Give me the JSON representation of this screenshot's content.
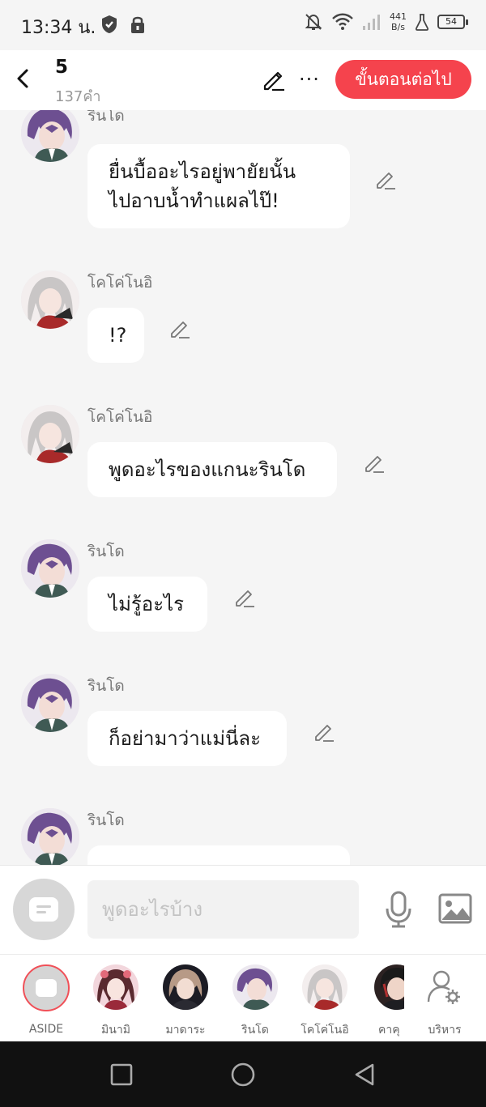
{
  "status_bar": {
    "time": "13:34 น.",
    "speed_value": "441",
    "speed_unit": "B/s",
    "battery": "54"
  },
  "header": {
    "title": "5",
    "subtitle": "137คำ",
    "next_button": "ขั้นตอนต่อไป",
    "more_label": "···"
  },
  "messages": [
    {
      "name": "รินโด",
      "text_lines": [
        "ยื่นบื้ออะไรอยู่พายัยนั้น",
        "ไปอาบน้ำทำแผลไป๊!"
      ]
    },
    {
      "name": "โคโค่โนอิ",
      "text_lines": [
        "!?"
      ]
    },
    {
      "name": "โคโค่โนอิ",
      "text_lines": [
        "พูดอะไรของแกนะรินโด"
      ]
    },
    {
      "name": "รินโด",
      "text_lines": [
        "ไม่รู้อะไร"
      ]
    },
    {
      "name": "รินโด",
      "text_lines": [
        "ก็อย่ามาว่าแม่นี่ละ"
      ]
    },
    {
      "name": "รินโด",
      "text_lines": [
        ""
      ]
    }
  ],
  "input": {
    "placeholder": "พูดอะไรบ้าง"
  },
  "characters": [
    {
      "label": "ASIDE"
    },
    {
      "label": "มินามิ"
    },
    {
      "label": "มาดาระ"
    },
    {
      "label": "รินโด"
    },
    {
      "label": "โคโค่โนอิ"
    },
    {
      "label": "คาคุ"
    },
    {
      "label": "บริหาร"
    }
  ],
  "colors": {
    "accent": "#f5434d",
    "background": "#f5f5f5",
    "bubble": "#ffffff"
  }
}
